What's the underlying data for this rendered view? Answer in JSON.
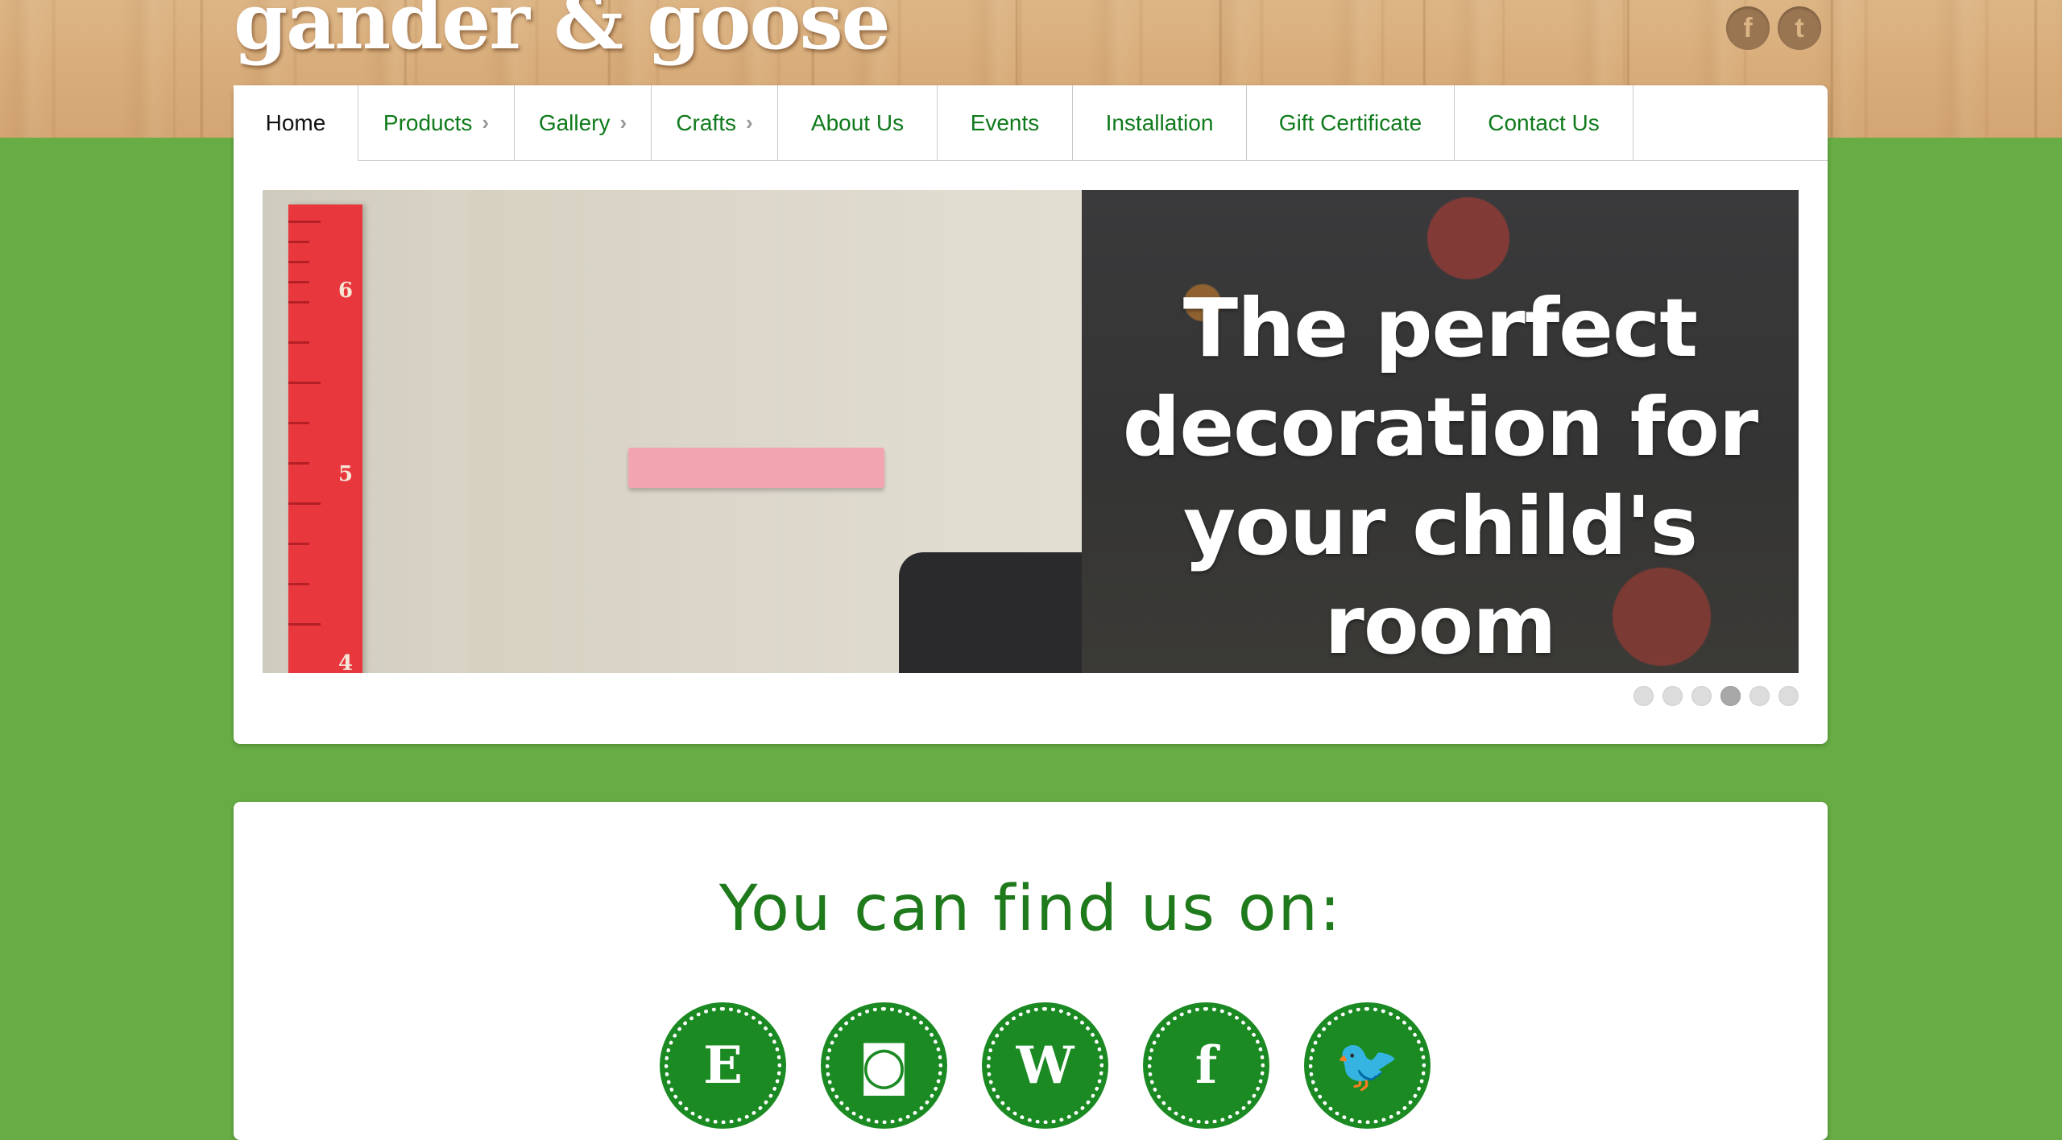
{
  "brand": {
    "name": "gander & goose"
  },
  "header_social": [
    {
      "icon": "facebook-icon",
      "glyph": "f"
    },
    {
      "icon": "twitter-icon",
      "glyph": "t"
    }
  ],
  "nav": {
    "items": [
      {
        "label": "Home",
        "active": true,
        "has_submenu": false
      },
      {
        "label": "Products",
        "active": false,
        "has_submenu": true
      },
      {
        "label": "Gallery",
        "active": false,
        "has_submenu": true
      },
      {
        "label": "Crafts",
        "active": false,
        "has_submenu": true
      },
      {
        "label": "About Us",
        "active": false,
        "has_submenu": false
      },
      {
        "label": "Events",
        "active": false,
        "has_submenu": false
      },
      {
        "label": "Installation",
        "active": false,
        "has_submenu": false
      },
      {
        "label": "Gift Certificate",
        "active": false,
        "has_submenu": false
      },
      {
        "label": "Contact Us",
        "active": false,
        "has_submenu": false
      }
    ],
    "submenu_glyph": "›"
  },
  "banner": {
    "headline": "The perfect\ndecoration for\nyour child's room",
    "ruler_numbers": [
      "6",
      "5",
      "4"
    ],
    "slide_count": 6,
    "active_slide": 4
  },
  "find_us": {
    "title": "You can find us on:",
    "badges": [
      {
        "icon": "etsy-icon",
        "glyph": "E"
      },
      {
        "icon": "instagram-icon",
        "glyph": "◙"
      },
      {
        "icon": "wordpress-icon",
        "glyph": "W"
      },
      {
        "icon": "facebook-icon",
        "glyph": "f"
      },
      {
        "icon": "twitter-icon",
        "glyph": "🐦"
      }
    ]
  },
  "colors": {
    "page_green": "#67ac45",
    "nav_link": "#0f7a1b",
    "badge_green": "#1b8a23",
    "wood": "#dcb585"
  }
}
